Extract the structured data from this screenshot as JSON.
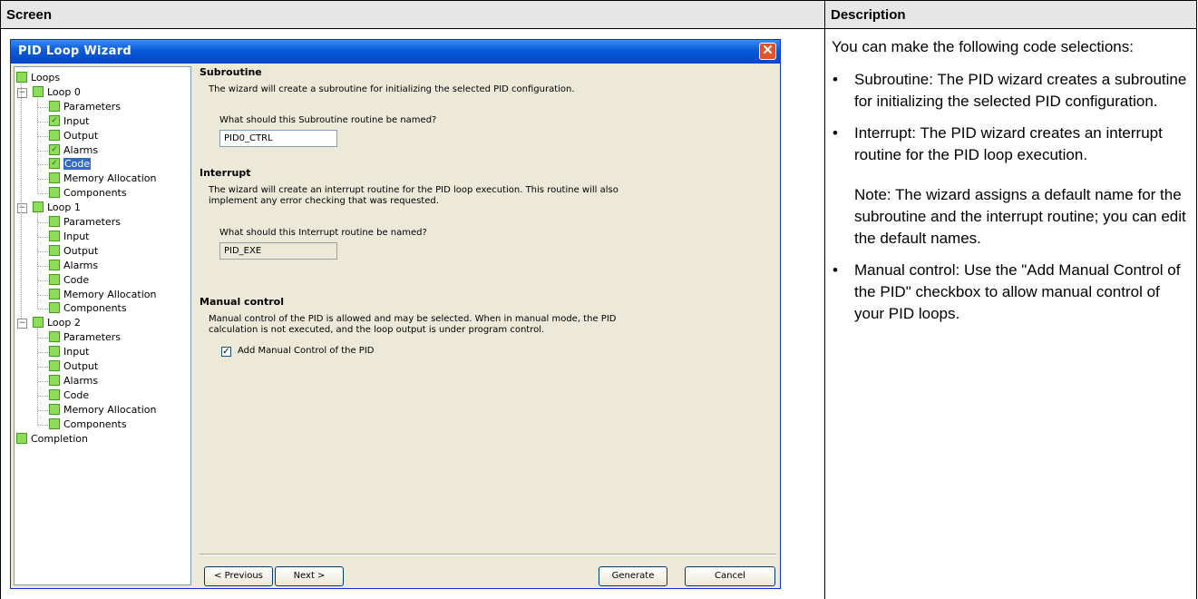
{
  "doc": {
    "screen_header": "Screen",
    "description_header": "Description",
    "intro": "You can make the following code selections:",
    "bullets": [
      "Subroutine: The PID wizard creates a subroutine for initializing the selected PID configuration.",
      "Interrupt: The PID wizard creates an interrupt routine for the PID loop execution.",
      "Manual control: Use the \"Add Manual Control of the PID\" checkbox to allow manual control of your PID loops."
    ],
    "note": "Note: The wizard assigns a default name for the subroutine and the interrupt routine; you can edit the default names."
  },
  "window": {
    "title": "PID Loop Wizard",
    "close_glyph": "✕"
  },
  "tree": {
    "root": "Loops",
    "loops": [
      {
        "label": "Loop 0",
        "children": [
          "Parameters",
          "Input",
          "Output",
          "Alarms",
          "Code",
          "Memory Allocation",
          "Components"
        ]
      },
      {
        "label": "Loop 1",
        "children": [
          "Parameters",
          "Input",
          "Output",
          "Alarms",
          "Code",
          "Memory Allocation",
          "Components"
        ]
      },
      {
        "label": "Loop 2",
        "children": [
          "Parameters",
          "Input",
          "Output",
          "Alarms",
          "Code",
          "Memory Allocation",
          "Components"
        ]
      }
    ],
    "completion": "Completion",
    "checked_items": [
      "Input",
      "Alarms",
      "Code"
    ],
    "selected_item": "Code"
  },
  "content": {
    "subroutine": {
      "title": "Subroutine",
      "description": "The wizard will create a subroutine for initializing the selected PID configuration.",
      "question": "What should this Subroutine routine be named?",
      "value": "PID0_CTRL"
    },
    "interrupt": {
      "title": "Interrupt",
      "description_line1": "The wizard will create an interrupt routine for the PID loop execution.  This routine will also",
      "description_line2": "implement any error checking that was requested.",
      "question": "What should this Interrupt routine be named?",
      "value": "PID_EXE"
    },
    "manual": {
      "title": "Manual control",
      "description_line1": "Manual control of the PID is allowed and may be selected.  When in manual mode, the PID",
      "description_line2": "calculation is not executed, and the loop output is under program control.",
      "checkbox_label": "Add Manual Control of the PID",
      "checkbox_mark": "✓"
    }
  },
  "buttons": {
    "previous": "< Previous",
    "next": "Next >",
    "generate": "Generate",
    "cancel": "Cancel"
  },
  "colors": {
    "title_bar": "#0a5ad8",
    "selection": "#316ac5",
    "checkbox_green": "#8fdc5a"
  }
}
